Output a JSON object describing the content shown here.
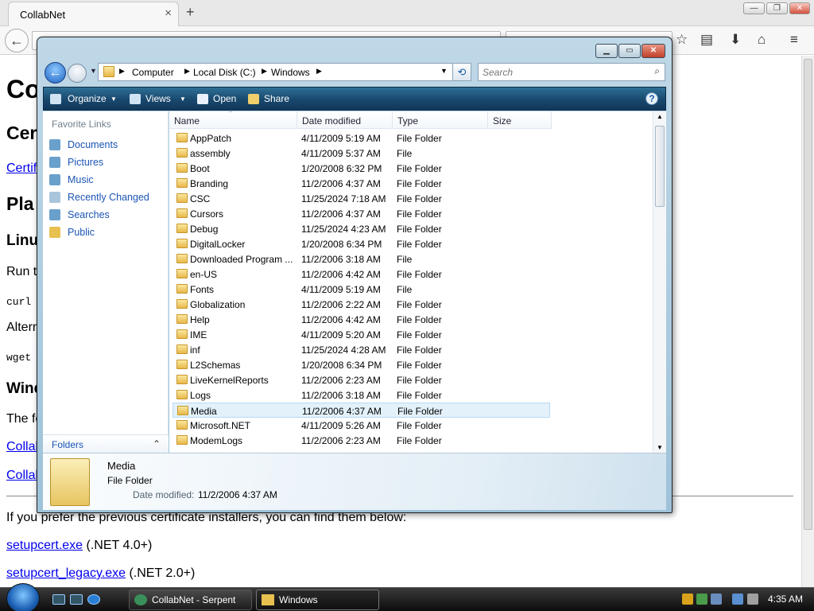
{
  "browser": {
    "tab_title": "CollabNet",
    "tab_close": "×",
    "new_tab": "+",
    "win_min": "—",
    "win_max": "❐",
    "win_close": "✕",
    "back": "←"
  },
  "page": {
    "h1": "Co",
    "h2": "Cer",
    "link1": "Certif",
    "h2b": "Pla",
    "h3a": "Linu",
    "p_run": "Run th",
    "code1": "curl",
    "p_alt": "Altern",
    "code2": "wget",
    "h3b": "Wind",
    "p_fol": "The fo",
    "link2": "Collab",
    "link3": "Collab",
    "p_prev": "If you prefer the previous certificate installers, you can find them below:",
    "link_setup": "setupcert.exe",
    "setup_note": " (.NET 4.0+)",
    "link_legacy": "setupcert_legacy.exe",
    "legacy_note": " (.NET 2.0+)"
  },
  "explorer": {
    "address": [
      "Computer",
      "Local Disk (C:)",
      "Windows"
    ],
    "search_placeholder": "Search",
    "toolbar": {
      "organize": "Organize",
      "views": "Views",
      "open": "Open",
      "share": "Share"
    },
    "favorite_links_label": "Favorite Links",
    "favorites": [
      "Documents",
      "Pictures",
      "Music",
      "Recently Changed",
      "Searches",
      "Public"
    ],
    "folders_label": "Folders",
    "columns": [
      "Name",
      "Date modified",
      "Type",
      "Size"
    ],
    "rows": [
      {
        "name": "AppPatch",
        "date": "4/11/2009 5:19 AM",
        "type": "File Folder"
      },
      {
        "name": "assembly",
        "date": "4/11/2009 5:37 AM",
        "type": "File"
      },
      {
        "name": "Boot",
        "date": "1/20/2008 6:32 PM",
        "type": "File Folder"
      },
      {
        "name": "Branding",
        "date": "11/2/2006 4:37 AM",
        "type": "File Folder"
      },
      {
        "name": "CSC",
        "date": "11/25/2024 7:18 AM",
        "type": "File Folder"
      },
      {
        "name": "Cursors",
        "date": "11/2/2006 4:37 AM",
        "type": "File Folder"
      },
      {
        "name": "Debug",
        "date": "11/25/2024 4:23 AM",
        "type": "File Folder"
      },
      {
        "name": "DigitalLocker",
        "date": "1/20/2008 6:34 PM",
        "type": "File Folder"
      },
      {
        "name": "Downloaded Program ...",
        "date": "11/2/2006 3:18 AM",
        "type": "File"
      },
      {
        "name": "en-US",
        "date": "11/2/2006 4:42 AM",
        "type": "File Folder"
      },
      {
        "name": "Fonts",
        "date": "4/11/2009 5:19 AM",
        "type": "File"
      },
      {
        "name": "Globalization",
        "date": "11/2/2006 2:22 AM",
        "type": "File Folder"
      },
      {
        "name": "Help",
        "date": "11/2/2006 4:42 AM",
        "type": "File Folder"
      },
      {
        "name": "IME",
        "date": "4/11/2009 5:20 AM",
        "type": "File Folder"
      },
      {
        "name": "inf",
        "date": "11/25/2024 4:28 AM",
        "type": "File Folder"
      },
      {
        "name": "L2Schemas",
        "date": "1/20/2008 6:34 PM",
        "type": "File Folder"
      },
      {
        "name": "LiveKernelReports",
        "date": "11/2/2006 2:23 AM",
        "type": "File Folder"
      },
      {
        "name": "Logs",
        "date": "11/2/2006 3:18 AM",
        "type": "File Folder"
      },
      {
        "name": "Media",
        "date": "11/2/2006 4:37 AM",
        "type": "File Folder"
      },
      {
        "name": "Microsoft.NET",
        "date": "4/11/2009 5:26 AM",
        "type": "File Folder"
      },
      {
        "name": "ModemLogs",
        "date": "11/2/2006 2:23 AM",
        "type": "File Folder"
      }
    ],
    "selected_index": 18,
    "details": {
      "name": "Media",
      "type": "File Folder",
      "date_label": "Date modified:",
      "date_value": "11/2/2006 4:37 AM"
    }
  },
  "taskbar": {
    "tasks": [
      "CollabNet - Serpent",
      "Windows"
    ],
    "clock": "4:35 AM"
  }
}
